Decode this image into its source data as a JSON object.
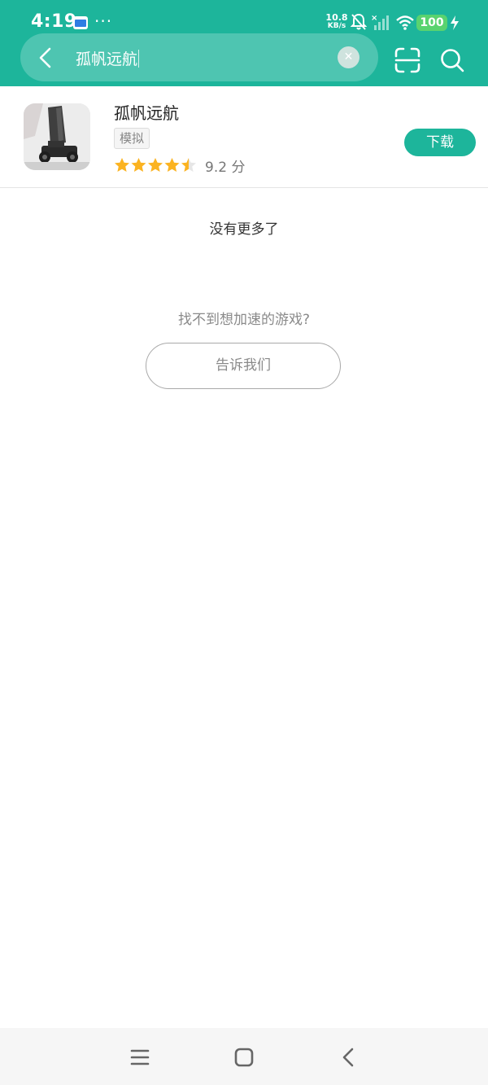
{
  "status_bar": {
    "time": "4:19",
    "more": "···",
    "net_speed_value": "10.8",
    "net_speed_unit": "KB/s",
    "battery": "100",
    "icons": [
      "calendar-app-icon",
      "bell-muted-icon",
      "cell-signal-off-icon",
      "wifi-icon",
      "charging-icon"
    ]
  },
  "search": {
    "query": "孤帆远航",
    "icons": [
      "back-arrow-icon",
      "clear-icon",
      "scan-icon",
      "search-icon"
    ]
  },
  "result": {
    "title": "孤帆远航",
    "tag": "模拟",
    "rating_stars": 4.5,
    "rating_text": "9.2 分",
    "download_label": "下载"
  },
  "footer": {
    "no_more": "没有更多了",
    "cant_find": "找不到想加速的游戏?",
    "tell_us_label": "告诉我们"
  },
  "nav": {
    "icons": [
      "menu-icon",
      "home-square-icon",
      "back-icon"
    ]
  },
  "colors": {
    "accent": "#1db59b",
    "star": "#fbb321",
    "battery": "#59d36f"
  }
}
